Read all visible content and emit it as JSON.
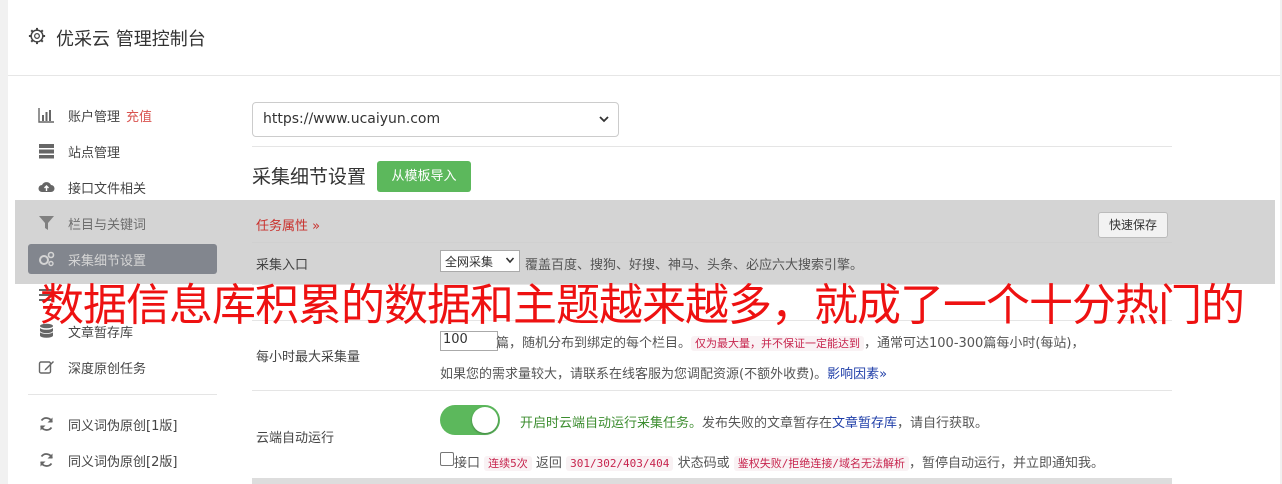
{
  "header": {
    "title": "优采云 管理控制台"
  },
  "sidebar": {
    "items": [
      {
        "label": "账户管理",
        "extra": "充值",
        "icon": "bar-chart-icon"
      },
      {
        "label": "站点管理",
        "icon": "server-icon"
      },
      {
        "label": "接口文件相关",
        "icon": "cloud-upload-icon"
      },
      {
        "label": "栏目与关键词",
        "icon": "filter-icon"
      },
      {
        "label": "采集细节设置",
        "icon": "cogs-icon"
      },
      {
        "label": "",
        "icon": "list-icon"
      },
      {
        "label": "文章暂存库",
        "icon": "database-icon"
      },
      {
        "label": "深度原创任务",
        "icon": "edit-icon"
      },
      {
        "label": "同义词伪原创[1版]",
        "icon": "refresh-icon"
      },
      {
        "label": "同义词伪原创[2版]",
        "icon": "refresh-icon"
      }
    ]
  },
  "site_select": {
    "value": "https://www.ucaiyun.com"
  },
  "section": {
    "title": "采集细节设置",
    "import_button": "从模板导入",
    "task_attr": "任务属性 »",
    "quick_save": "快速保存"
  },
  "rows": {
    "entry": {
      "label": "采集入口",
      "select_value": "全网采集",
      "desc": "覆盖百度、搜狗、好搜、神马、头条、必应六大搜索引擎。"
    },
    "hourly": {
      "label": "每小时最大采集量",
      "value": "100",
      "text1": "篇，随机分布到绑定的每个栏目。",
      "code1": "仅为最大量，并不保证一定能达到",
      "text2": "，通常可达100-300篇每小时(每站)，",
      "line2": "如果您的需求量较大，请联系在线客服为您调配资源(不额外收费)。",
      "link": "影响因素»"
    },
    "cloud": {
      "label": "云端自动运行",
      "enabled_text": "开启时云端自动运行采集任务。",
      "text_a": "发布失败的文章暂存在",
      "link": "文章暂存库",
      "text_b": "，请自行获取。",
      "cb_prefix": "接口",
      "code1": "连续5次",
      "cb_mid1": "返回",
      "code2": "301/302/403/404",
      "cb_mid2": "状态码或",
      "code3": "鉴权失败/拒绝连接/域名无法解析",
      "cb_suffix": "，暂停自动运行，并立即通知我。"
    }
  },
  "overlay_text": "数据信息库积累的数据和主题越来越多，就成了一个十分热门的",
  "colors": {
    "accent_green": "#5cb85c",
    "danger_red": "#d9534f",
    "overlay_red": "#ee1111"
  }
}
